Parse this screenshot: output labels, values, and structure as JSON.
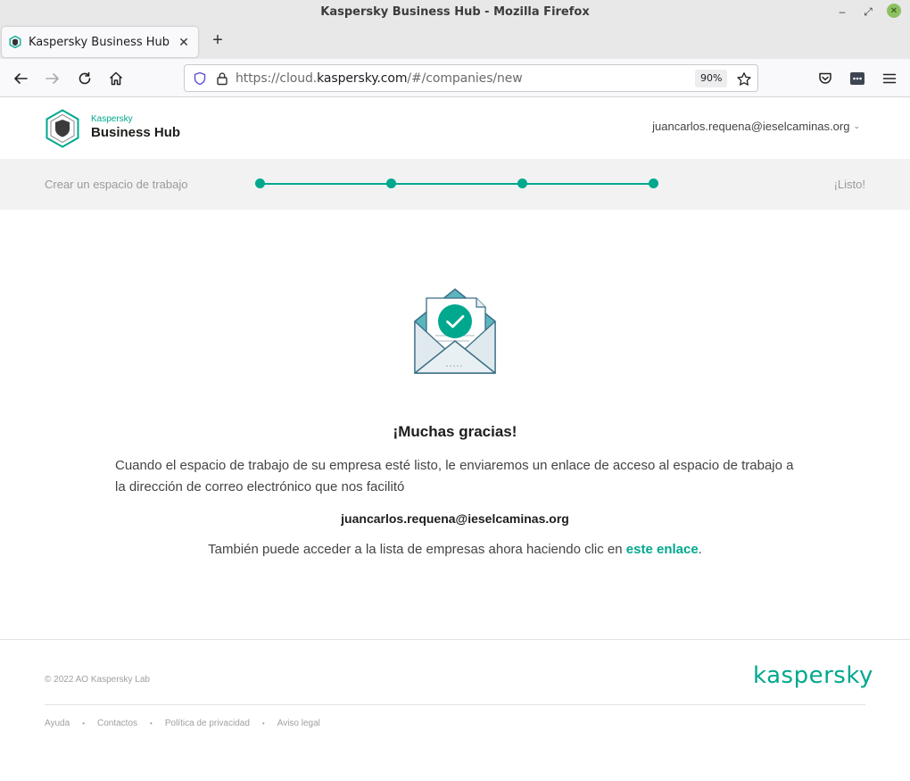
{
  "window": {
    "title": "Kaspersky Business Hub - Mozilla Firefox",
    "min_glyph": "–",
    "max_glyph": "⤢",
    "close_glyph": "✕"
  },
  "tab": {
    "label": "Kaspersky Business Hub",
    "close_glyph": "✕",
    "new_tab_glyph": "+"
  },
  "navbar": {
    "url_prefix": "https://cloud.",
    "url_domain": "kaspersky.com",
    "url_suffix": "/#/companies/new",
    "zoom": "90%"
  },
  "header": {
    "brand_small": "Kaspersky",
    "brand_big": "Business Hub",
    "account_email": "juancarlos.requena@ieselcaminas.org",
    "account_caret": "⌄"
  },
  "progress": {
    "start_label": "Crear un espacio de trabajo",
    "end_label": "¡Listo!",
    "steps_completed": 4,
    "steps_total": 4
  },
  "main": {
    "heading": "¡Muchas gracias!",
    "description": "Cuando el espacio de trabajo de su empresa esté listo, le enviaremos un enlace de acceso al espacio de trabajo a la dirección de correo electrónico que nos facilitó",
    "email": "juancarlos.requena@ieselcaminas.org",
    "access_text": "También puede acceder a la lista de empresas ahora haciendo clic en ",
    "access_link": "este enlace",
    "access_end": "."
  },
  "footer": {
    "copyright": "© 2022 AO Kaspersky Lab",
    "brand": "kaspersky",
    "links": [
      "Ayuda",
      "Contactos",
      "Política de privacidad",
      "Aviso legal"
    ],
    "separator": "•"
  },
  "colors": {
    "accent": "#00a88e",
    "text_dark": "#1d1d1b",
    "text_muted": "#a0a0a0"
  },
  "icons": {
    "nav": [
      "back-icon",
      "forward-icon",
      "reload-icon",
      "home-icon"
    ],
    "url": [
      "shield-icon",
      "lock-icon",
      "bookmark-star-icon"
    ],
    "toolbar": [
      "pocket-icon",
      "extension-icon",
      "menu-icon"
    ],
    "illustration": "envelope-check-icon"
  }
}
